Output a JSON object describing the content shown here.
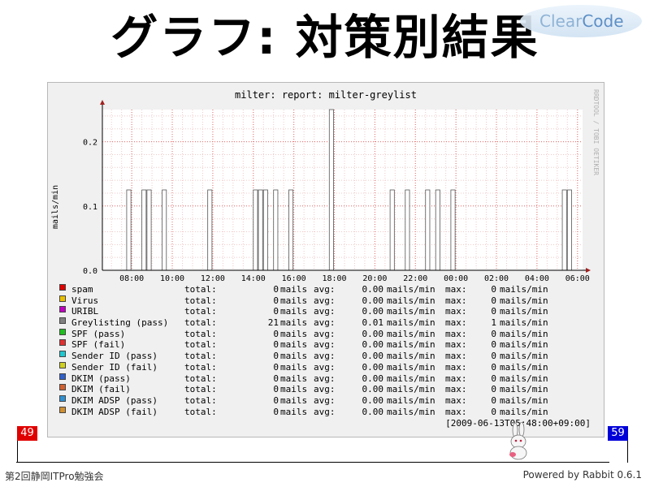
{
  "slide": {
    "title": "グラフ: 対策別結果",
    "logo_text_a": "Clear",
    "logo_text_b": "Code",
    "footer_left": "第2回静岡ITPro勉強会",
    "footer_right": "Powered by Rabbit 0.6.1",
    "page_current": "49",
    "page_total": "59"
  },
  "graph": {
    "title": "milter: report: milter-greylist",
    "watermark": "RRDTOOL / TOBI OETIKER",
    "timestamp": "[2009-06-13T05:48:00+09:00]"
  },
  "chart_data": {
    "type": "bar",
    "ylabel": "mails/min",
    "ylim": [
      0,
      0.25
    ],
    "yticks": [
      {
        "v": 0,
        "label": "0.0"
      },
      {
        "v": 0.1,
        "label": "0.1"
      },
      {
        "v": 0.2,
        "label": "0.2"
      }
    ],
    "xticks": [
      "08:00",
      "10:00",
      "12:00",
      "14:00",
      "16:00",
      "18:00",
      "20:00",
      "22:00",
      "00:00",
      "02:00",
      "04:00",
      "06:00"
    ],
    "x_range_hours": [
      6.55,
      30.25
    ],
    "series": [
      {
        "name": "Greylisting (pass)",
        "color": "#ffffff",
        "points": [
          {
            "t": 7.75,
            "v": 0.125
          },
          {
            "t": 8.5,
            "v": 0.125
          },
          {
            "t": 8.75,
            "v": 0.125
          },
          {
            "t": 9.5,
            "v": 0.125
          },
          {
            "t": 11.75,
            "v": 0.125
          },
          {
            "t": 14.0,
            "v": 0.125
          },
          {
            "t": 14.25,
            "v": 0.125
          },
          {
            "t": 14.5,
            "v": 0.125
          },
          {
            "t": 15.0,
            "v": 0.125
          },
          {
            "t": 15.75,
            "v": 0.125
          },
          {
            "t": 17.75,
            "v": 0.25
          },
          {
            "t": 20.75,
            "v": 0.125
          },
          {
            "t": 21.5,
            "v": 0.125
          },
          {
            "t": 22.5,
            "v": 0.125
          },
          {
            "t": 23.0,
            "v": 0.125
          },
          {
            "t": 23.75,
            "v": 0.125
          },
          {
            "t": 29.25,
            "v": 0.125
          },
          {
            "t": 29.5,
            "v": 0.125
          }
        ]
      }
    ]
  },
  "legend": {
    "total_label": "total:",
    "unit_mails": "mails",
    "avg_label": "avg:",
    "unit_rate": "mails/min",
    "max_label": "max:",
    "items": [
      {
        "name": "spam",
        "color": "#e00000",
        "total": "0",
        "avg": "0.00",
        "max": "0"
      },
      {
        "name": "Virus",
        "color": "#e8c000",
        "total": "0",
        "avg": "0.00",
        "max": "0"
      },
      {
        "name": "URIBL",
        "color": "#c000c0",
        "total": "0",
        "avg": "0.00",
        "max": "0"
      },
      {
        "name": "Greylisting (pass)",
        "color": "#808080",
        "total": "21",
        "avg": "0.01",
        "max": "1"
      },
      {
        "name": "SPF (pass)",
        "color": "#20c020",
        "total": "0",
        "avg": "0.00",
        "max": "0"
      },
      {
        "name": "SPF (fail)",
        "color": "#e03030",
        "total": "0",
        "avg": "0.00",
        "max": "0"
      },
      {
        "name": "Sender ID (pass)",
        "color": "#20c8d0",
        "total": "0",
        "avg": "0.00",
        "max": "0"
      },
      {
        "name": "Sender ID (fail)",
        "color": "#d0d020",
        "total": "0",
        "avg": "0.00",
        "max": "0"
      },
      {
        "name": "DKIM (pass)",
        "color": "#3060c8",
        "total": "0",
        "avg": "0.00",
        "max": "0"
      },
      {
        "name": "DKIM (fail)",
        "color": "#d06030",
        "total": "0",
        "avg": "0.00",
        "max": "0"
      },
      {
        "name": "DKIM ADSP (pass)",
        "color": "#3090d0",
        "total": "0",
        "avg": "0.00",
        "max": "0"
      },
      {
        "name": "DKIM ADSP (fail)",
        "color": "#d09030",
        "total": "0",
        "avg": "0.00",
        "max": "0"
      }
    ]
  }
}
